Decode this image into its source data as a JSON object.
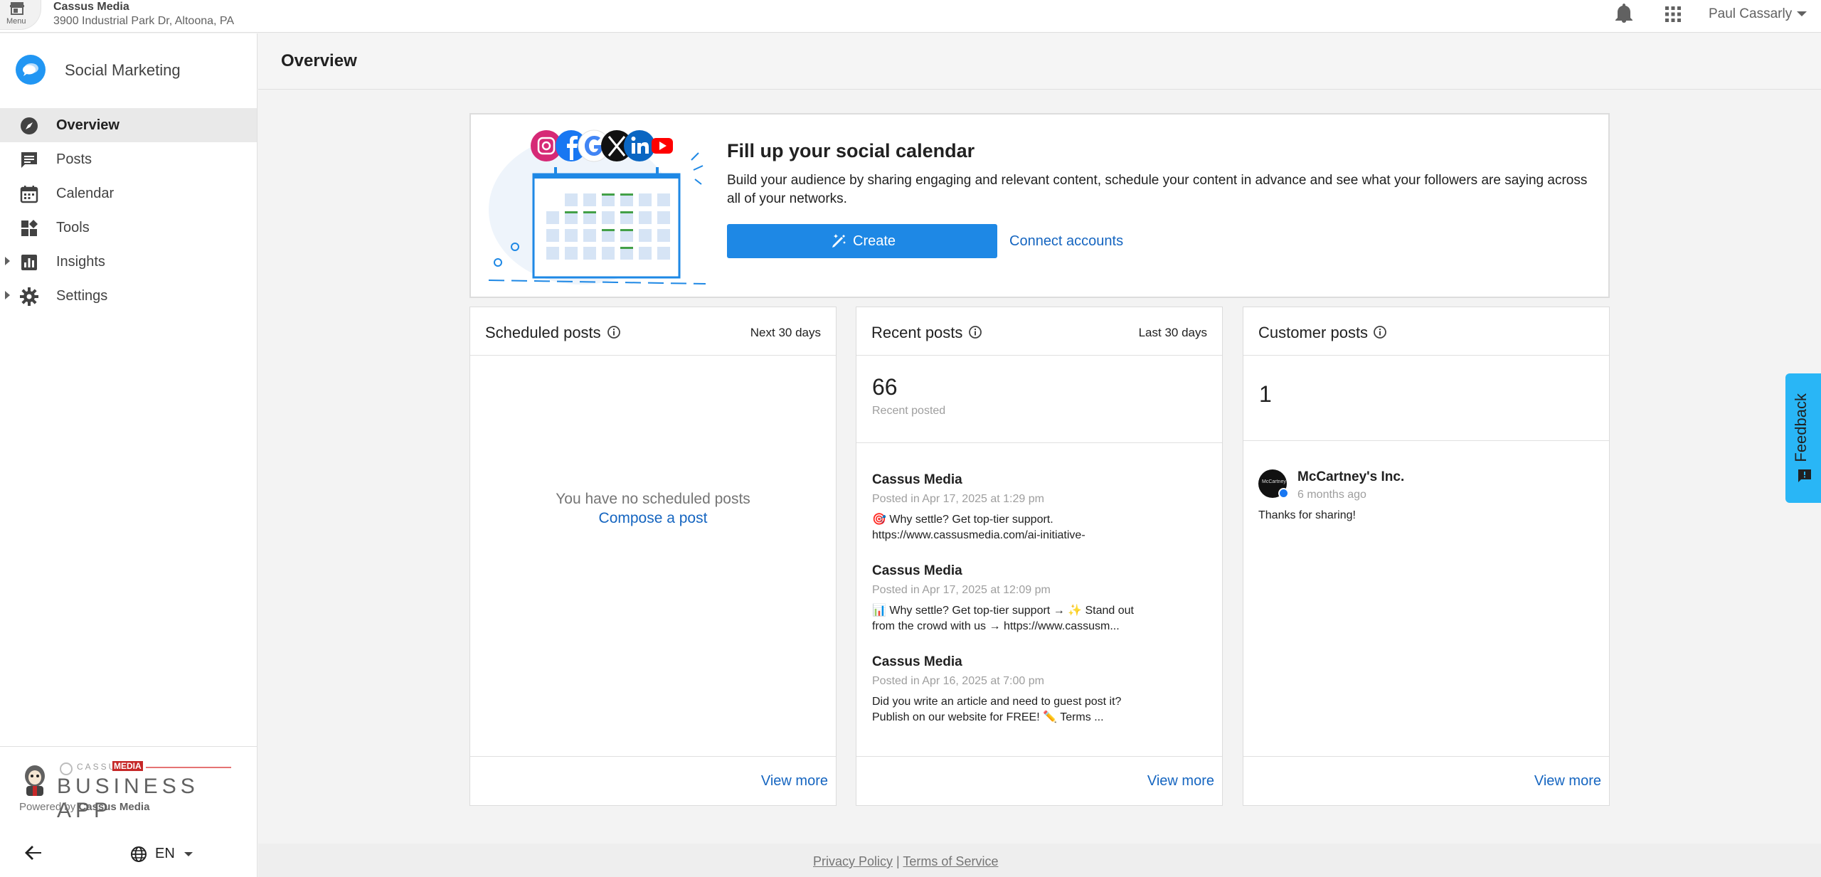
{
  "topbar": {
    "menu_label": "Menu",
    "business_name": "Cassus Media",
    "business_address": "3900 Industrial Park Dr, Altoona, PA",
    "user_name": "Paul Cassarly"
  },
  "sidebar": {
    "app_title": "Social Marketing",
    "items": [
      {
        "label": "Overview",
        "icon": "compass-icon",
        "active": true
      },
      {
        "label": "Posts",
        "icon": "chat-icon"
      },
      {
        "label": "Calendar",
        "icon": "calendar-icon"
      },
      {
        "label": "Tools",
        "icon": "widgets-icon"
      },
      {
        "label": "Insights",
        "icon": "bar-chart-icon",
        "expandable": true
      },
      {
        "label": "Settings",
        "icon": "gear-icon",
        "expandable": true
      }
    ],
    "brand": {
      "cassus": "CASSUS",
      "media": "MEDIA",
      "app": "BUSINESS APP",
      "powered_prefix": "Powered by",
      "powered_by": "Cassus Media"
    },
    "language": "EN"
  },
  "page": {
    "title": "Overview"
  },
  "hero": {
    "title": "Fill up your social calendar",
    "description": "Build your audience by sharing engaging and relevant content, schedule your content in advance and see what your followers are saying across all of your networks.",
    "create_label": "Create",
    "connect_label": "Connect accounts"
  },
  "scheduled": {
    "title": "Scheduled posts",
    "range": "Next 30 days",
    "empty": "You have no scheduled posts",
    "compose": "Compose a post",
    "view_more": "View more"
  },
  "recent": {
    "title": "Recent posts",
    "range": "Last 30 days",
    "count": "66",
    "count_label": "Recent posted",
    "posts": [
      {
        "author": "Cassus Media",
        "meta": "Posted in Apr 17, 2025 at 1:29 pm",
        "text": "🎯 Why settle? Get top-tier support. https://www.cassusmedia.com/ai-initiative-"
      },
      {
        "author": "Cassus Media",
        "meta": "Posted in Apr 17, 2025 at 12:09 pm",
        "text": "📊 Why settle? Get top-tier support → ✨ Stand out from the crowd with us → https://www.cassusm..."
      },
      {
        "author": "Cassus Media",
        "meta": "Posted in Apr 16, 2025 at 7:00 pm",
        "text": "Did you write an article and need to guest post it? Publish on our website for FREE! ✏️ Terms ..."
      }
    ],
    "view_more": "View more"
  },
  "customer": {
    "title": "Customer posts",
    "count": "1",
    "post": {
      "author": "McCartney's Inc.",
      "time": "6 months ago",
      "text": "Thanks for sharing!"
    },
    "view_more": "View more"
  },
  "footer": {
    "privacy": "Privacy Policy",
    "separator": "|",
    "terms": "Terms of Service"
  },
  "feedback": {
    "label": "Feedback"
  },
  "colors": {
    "primary": "#1e88e5",
    "link": "#1565c0",
    "feedback": "#29b6f6",
    "app_logo": "#2196f3"
  }
}
